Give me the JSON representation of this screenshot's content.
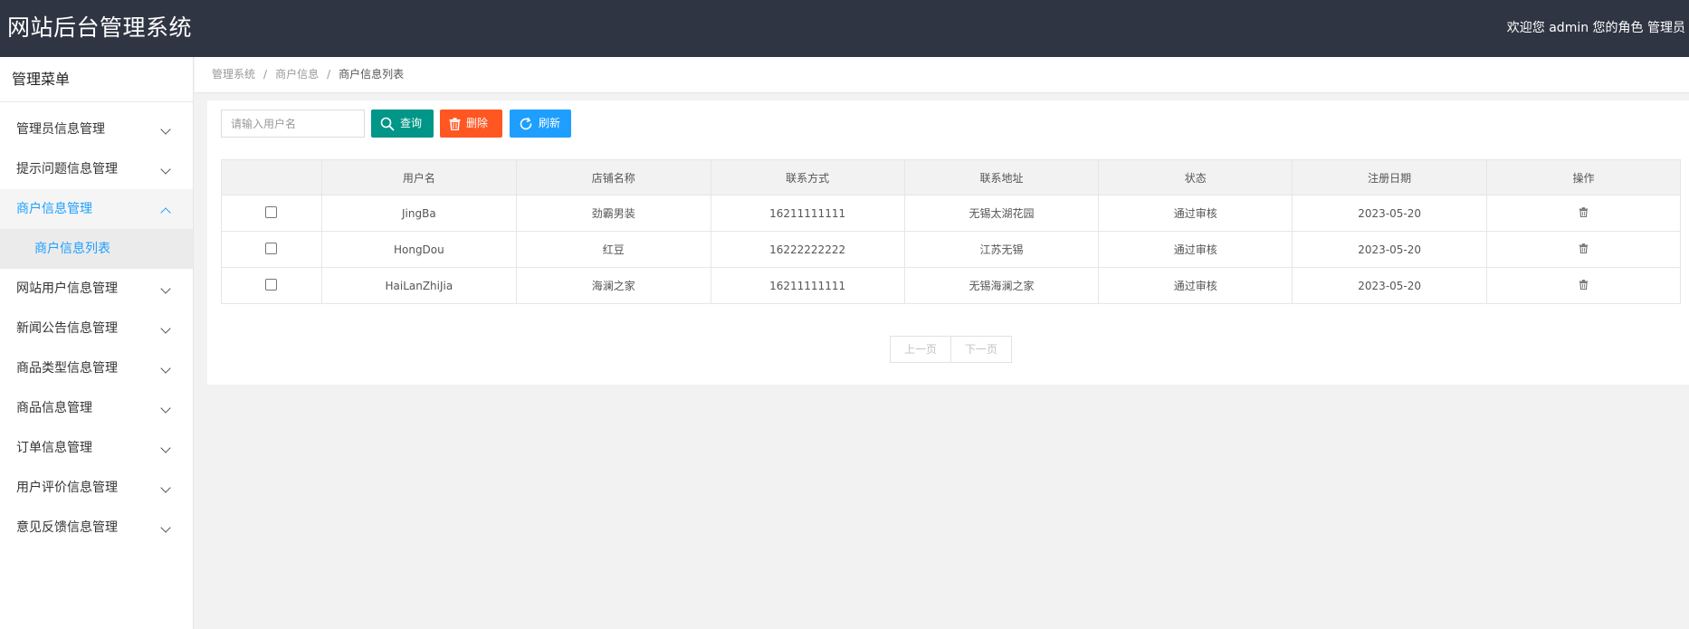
{
  "header": {
    "title": "网站后台管理系统",
    "user_info": "欢迎您 admin 您的角色 管理员"
  },
  "sidebar": {
    "title": "管理菜单",
    "items": [
      {
        "label": "管理员信息管理"
      },
      {
        "label": "提示问题信息管理"
      },
      {
        "label": "商户信息管理",
        "active": true,
        "children": [
          {
            "label": "商户信息列表"
          }
        ]
      },
      {
        "label": "网站用户信息管理"
      },
      {
        "label": "新闻公告信息管理"
      },
      {
        "label": "商品类型信息管理"
      },
      {
        "label": "商品信息管理"
      },
      {
        "label": "订单信息管理"
      },
      {
        "label": "用户评价信息管理"
      },
      {
        "label": "意见反馈信息管理"
      }
    ]
  },
  "breadcrumb": [
    "管理系统",
    "商户信息",
    "商户信息列表"
  ],
  "toolbar": {
    "search_placeholder": "请输入用户名",
    "search_label": "查询",
    "delete_label": "删除",
    "refresh_label": "刷新"
  },
  "table": {
    "columns": [
      "",
      "用户名",
      "店铺名称",
      "联系方式",
      "联系地址",
      "状态",
      "注册日期",
      "操作"
    ],
    "rows": [
      {
        "username": "JingBa",
        "shop": "劲霸男装",
        "phone": "16211111111",
        "address": "无锡太湖花园",
        "status": "通过审核",
        "date": "2023-05-20"
      },
      {
        "username": "HongDou",
        "shop": "红豆",
        "phone": "16222222222",
        "address": "江苏无锡",
        "status": "通过审核",
        "date": "2023-05-20"
      },
      {
        "username": "HaiLanZhiJia",
        "shop": "海澜之家",
        "phone": "16211111111",
        "address": "无锡海澜之家",
        "status": "通过审核",
        "date": "2023-05-20"
      }
    ]
  },
  "pager": {
    "prev_label": "上一页",
    "next_label": "下一页"
  },
  "colors": {
    "header_bg": "#2f3542",
    "accent": "#1e9fff",
    "search_btn": "#009688",
    "delete_btn": "#ff5722",
    "refresh_btn": "#1e9fff"
  },
  "icons": {
    "search": "search-icon",
    "delete": "trash-icon",
    "refresh": "refresh-icon",
    "row_action": "trash-icon",
    "menu_expand": "chevron-down-icon",
    "menu_collapse": "chevron-up-icon"
  }
}
